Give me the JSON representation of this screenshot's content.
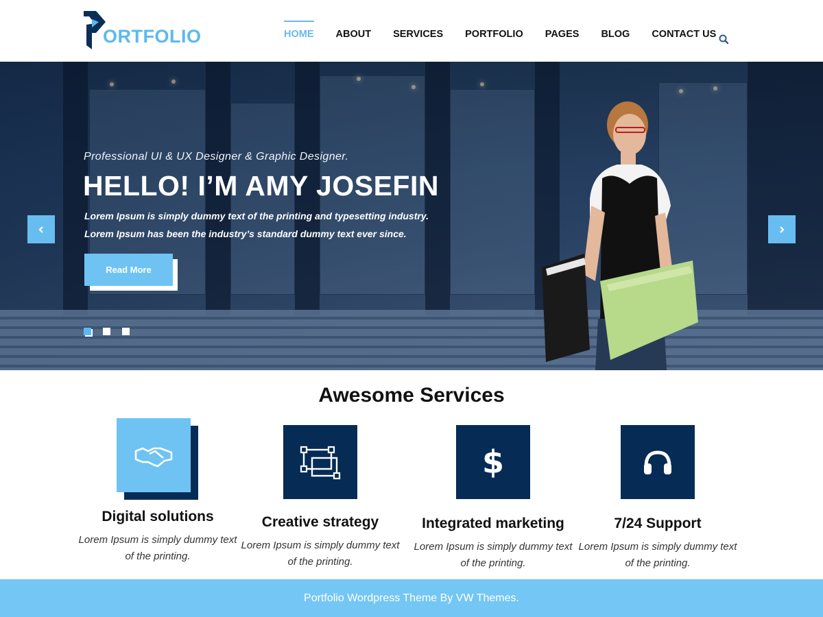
{
  "brand": {
    "logo_text": "ORTFOLIO",
    "logo_color": "#5cb9ee"
  },
  "nav": {
    "items": [
      {
        "label": "HOME",
        "active": true
      },
      {
        "label": "ABOUT",
        "active": false
      },
      {
        "label": "SERVICES",
        "active": false
      },
      {
        "label": "PORTFOLIO",
        "active": false
      },
      {
        "label": "PAGES",
        "active": false
      },
      {
        "label": "BLOG",
        "active": false
      },
      {
        "label": "CONTACT US",
        "active": false
      }
    ],
    "search_icon": "search-icon"
  },
  "hero": {
    "subtitle": "Professional UI & UX Designer & Graphic Designer.",
    "title": "HELLO! I’M AMY JOSEFIN",
    "text": "Lorem Ipsum is simply dummy text of the printing and typesetting industry. Lorem Ipsum has been the industry’s standard dummy text ever since.",
    "button_label": "Read More",
    "prev_icon": "chevron-left-icon",
    "next_icon": "chevron-right-icon",
    "slides_total": 3,
    "active_slide": 1
  },
  "services": {
    "title": "Awesome Services",
    "items": [
      {
        "name": "Digital solutions",
        "desc": "Lorem Ipsum is simply dummy text of the printing.",
        "icon": "handshake-icon"
      },
      {
        "name": "Creative strategy",
        "desc": "Lorem Ipsum is simply dummy text of the printing.",
        "icon": "vector-shape-icon"
      },
      {
        "name": "Integrated marketing",
        "desc": "Lorem Ipsum is simply dummy text of the printing.",
        "icon": "dollar-icon"
      },
      {
        "name": "7/24 Support",
        "desc": "Lorem Ipsum is simply dummy text of the printing.",
        "icon": "headphones-icon"
      }
    ]
  },
  "footer": {
    "text": "Portfolio Wordpress Theme By VW Themes."
  },
  "colors": {
    "accent": "#6fc3f3",
    "dark_navy": "#062c55",
    "footer_bg": "#74c6f4"
  }
}
